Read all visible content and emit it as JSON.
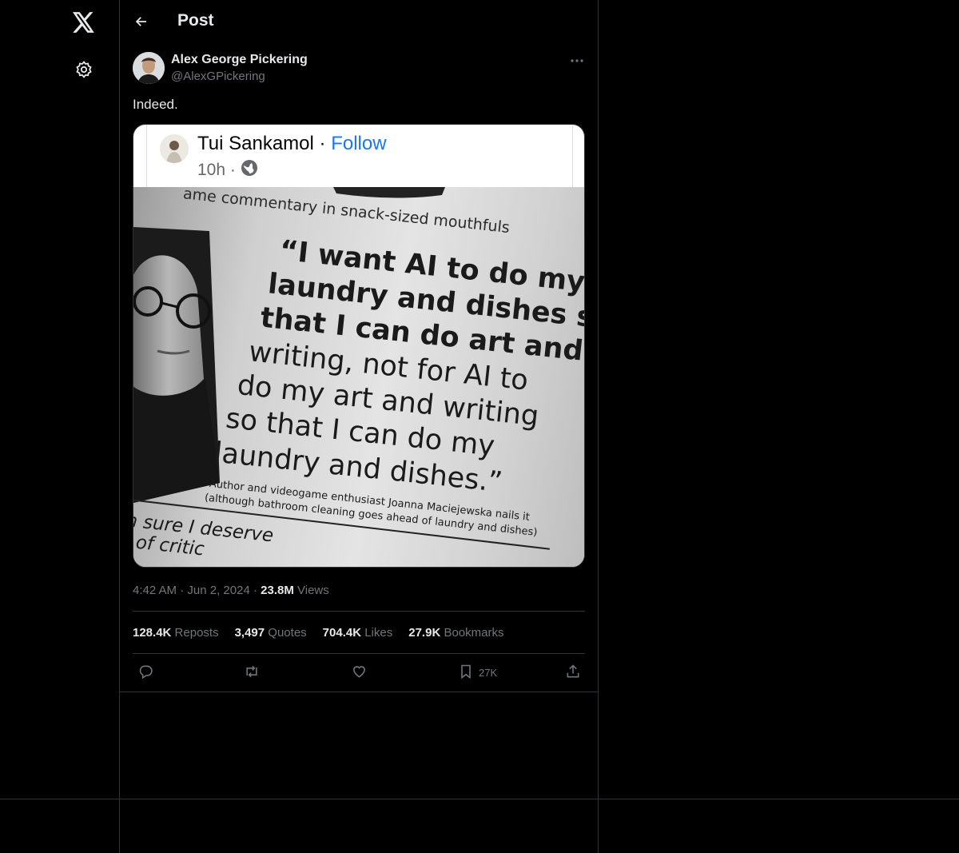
{
  "header": {
    "title": "Post"
  },
  "author": {
    "name": "Alex George Pickering",
    "handle": "@AlexGPickering"
  },
  "post": {
    "text": "Indeed."
  },
  "media": {
    "fb_name": "Tui Sankamol",
    "fb_separator": "·",
    "fb_follow": "Follow",
    "fb_time": "10h ·",
    "headline_fragment": "ame commentary in snack-sized mouthfuls",
    "quote_lines": [
      "“I want AI to do my",
      "laundry and dishes so",
      "that I can do art and",
      "writing, not for AI to",
      "do my art and writing",
      "so that I can do my",
      "laundry and dishes.”"
    ],
    "caption_1": "Author and videogame enthusiast Joanna Maciejewska nails it",
    "caption_2": "(although bathroom cleaning goes ahead of laundry and dishes)",
    "next_quote_1": "“I'm sure I deserve",
    "next_quote_2": "a lot of critic"
  },
  "meta": {
    "time": "4:42 AM",
    "sep1": "·",
    "date": "Jun 2, 2024",
    "sep2": "·",
    "views_value": "23.8M",
    "views_label": "Views"
  },
  "stats": {
    "reposts_value": "128.4K",
    "reposts_label": "Reposts",
    "quotes_value": "3,497",
    "quotes_label": "Quotes",
    "likes_value": "704.4K",
    "likes_label": "Likes",
    "bookmarks_value": "27.9K",
    "bookmarks_label": "Bookmarks"
  },
  "actions": {
    "bookmark_count": "27K"
  },
  "icons": [
    "x-logo-icon",
    "settings-gear-icon",
    "back-arrow-icon",
    "more-icon",
    "globe-icon",
    "reply-icon",
    "repost-icon",
    "like-icon",
    "bookmark-icon",
    "share-icon"
  ]
}
